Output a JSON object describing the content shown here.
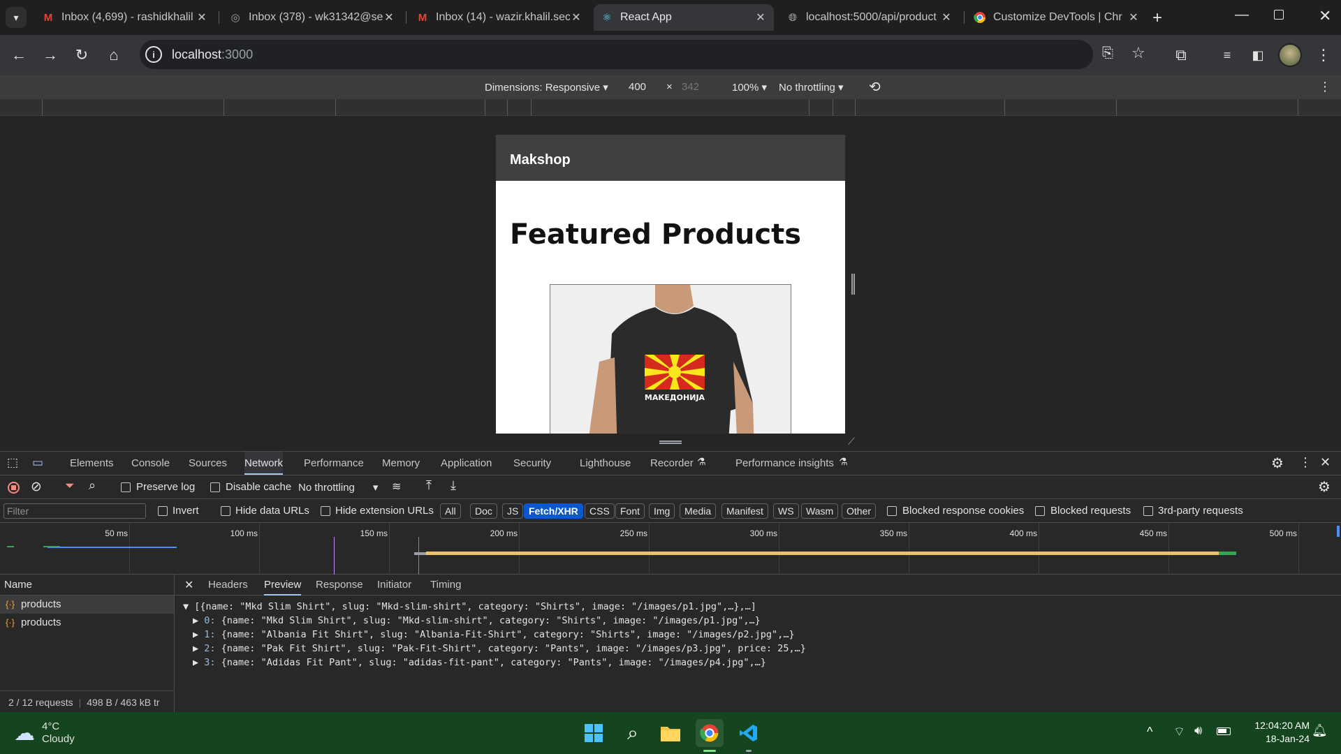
{
  "tabs": [
    {
      "title": "Inbox (4,699) - rashidkhalil",
      "icon": "gmail-icon"
    },
    {
      "title": "Inbox (378) - wk31342@se",
      "icon": "mail-icon"
    },
    {
      "title": "Inbox (14) - wazir.khalil.sec",
      "icon": "gmail-icon"
    },
    {
      "title": "React App",
      "icon": "react-icon"
    },
    {
      "title": "localhost:5000/api/product",
      "icon": "globe-icon"
    },
    {
      "title": "Customize DevTools | Chr",
      "icon": "chrome-icon"
    }
  ],
  "address": {
    "host": "localhost",
    "port": ":3000"
  },
  "device_toolbar": {
    "dimensions": "Dimensions: Responsive",
    "width": "400",
    "times": "×",
    "height": "342",
    "zoom": "100%",
    "throttling": "No throttling"
  },
  "app": {
    "brand": "Makshop",
    "heading": "Featured Products",
    "shirt_text": "МАКЕДОНИЈА"
  },
  "devtools": {
    "tabs": [
      "Elements",
      "Console",
      "Sources",
      "Network",
      "Performance",
      "Memory",
      "Application",
      "Security",
      "Lighthouse",
      "Recorder",
      "Performance insights"
    ],
    "active_tab": "Network",
    "preserve_log": "Preserve log",
    "disable_cache": "Disable cache",
    "throttling": "No throttling",
    "filter_placeholder": "Filter",
    "invert": "Invert",
    "hide_data_urls": "Hide data URLs",
    "hide_extension_urls": "Hide extension URLs",
    "type_filters": [
      "All",
      "Doc",
      "JS",
      "Fetch/XHR",
      "CSS",
      "Font",
      "Img",
      "Media",
      "Manifest",
      "WS",
      "Wasm",
      "Other"
    ],
    "active_filter": "Fetch/XHR",
    "blocked_cookies": "Blocked response cookies",
    "blocked_requests": "Blocked requests",
    "third_party": "3rd-party requests",
    "timeline_labels": [
      "50 ms",
      "100 ms",
      "150 ms",
      "200 ms",
      "250 ms",
      "300 ms",
      "350 ms",
      "400 ms",
      "450 ms",
      "500 ms"
    ],
    "name_header": "Name",
    "requests": [
      "products",
      "products"
    ],
    "status": "2 / 12 requests",
    "transfer": "498 B / 463 kB tr",
    "detail_tabs": [
      "Headers",
      "Preview",
      "Response",
      "Initiator",
      "Timing"
    ],
    "active_detail_tab": "Preview",
    "preview_root": "[{name: \"Mkd Slim Shirt\", slug: \"Mkd-slim-shirt\", category: \"Shirts\", image: \"/images/p1.jpg\",…},…]",
    "preview_items": [
      {
        "index": "0:",
        "text": "{name: \"Mkd Slim Shirt\", slug: \"Mkd-slim-shirt\", category: \"Shirts\", image: \"/images/p1.jpg\",…}"
      },
      {
        "index": "1:",
        "text": "{name: \"Albania Fit Shirt\", slug: \"Albania-Fit-Shirt\", category: \"Shirts\", image: \"/images/p2.jpg\",…}"
      },
      {
        "index": "2:",
        "text": "{name: \"Pak Fit Shirt\", slug: \"Pak-Fit-Shirt\", category: \"Pants\", image: \"/images/p3.jpg\", price: 25,…}"
      },
      {
        "index": "3:",
        "text": "{name: \"Adidas Fit Pant\", slug: \"adidas-fit-pant\", category: \"Pants\", image: \"/images/p4.jpg\",…}"
      }
    ]
  },
  "taskbar": {
    "temp": "4°C",
    "weather": "Cloudy",
    "time": "12:04:20 AM",
    "date": "18-Jan-24"
  },
  "colors": {
    "accent": "#a8c7fa",
    "active_chip": "#0b57d0",
    "taskbar": "#15451f",
    "waterfall": "#e9c46a"
  }
}
